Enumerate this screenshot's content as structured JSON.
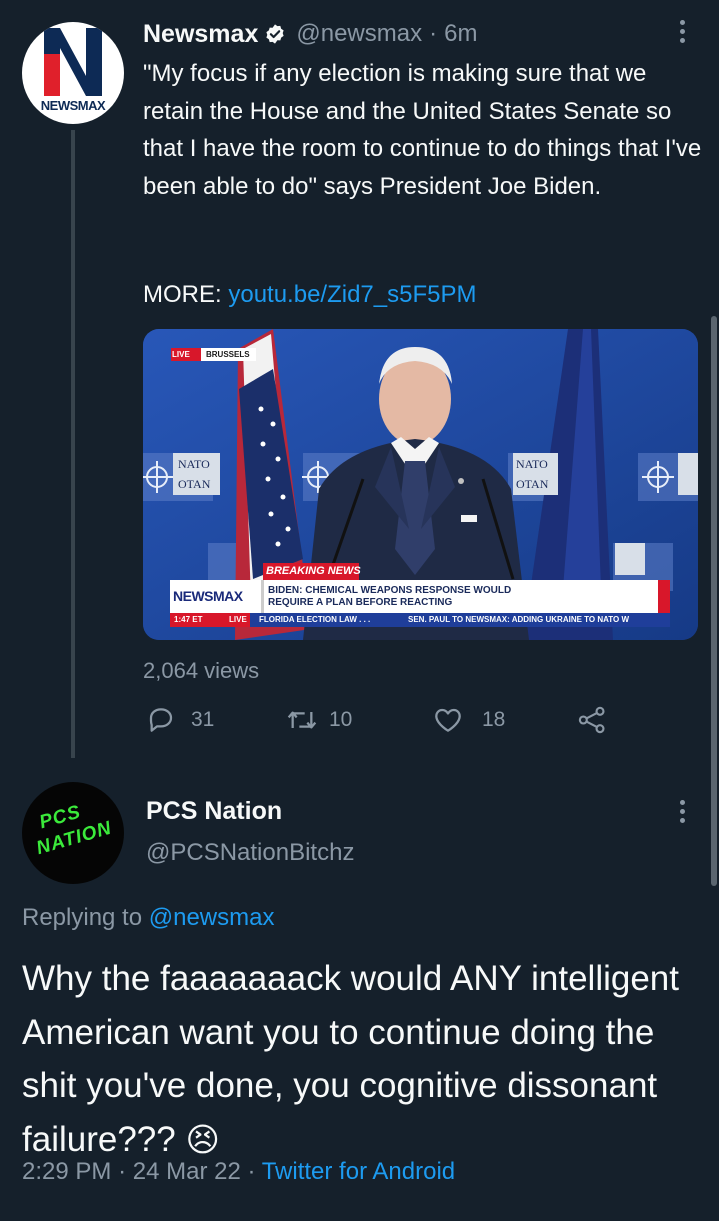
{
  "tweet": {
    "author_name": "Newsmax",
    "handle": "@newsmax",
    "separator": "·",
    "time_ago": "6m",
    "avatar_text": "NEWSMAX",
    "text": "\"My focus if any election is making sure that we retain the House and the United States Senate so that I have the room to continue to do things that I've been able to do\" says President Joe Biden.",
    "more_label": "MORE:",
    "more_link": "youtu.be/Zid7_s5F5PM",
    "video": {
      "live_tag": "LIVE",
      "location": "BRUSSELS",
      "nato_left": "NATO",
      "otan_left": "OTAN",
      "nato_right": "NATO",
      "otan_right": "OTAN",
      "breaking_label": "BREAKING NEWS",
      "channel": "NEWSMAX",
      "headline_line1": "BIDEN: CHEMICAL WEAPONS RESPONSE WOULD",
      "headline_line2": "REQUIRE A PLAN BEFORE REACTING",
      "clock": "1:47 ET",
      "live_label": "LIVE",
      "ticker1": "FLORIDA ELECTION LAW . . .",
      "ticker2": "SEN. PAUL TO NEWSMAX: ADDING UKRAINE TO NATO W"
    },
    "views": "2,064 views",
    "replies": "31",
    "retweets": "10",
    "likes": "18"
  },
  "reply": {
    "author_name": "PCS Nation",
    "handle": "@PCSNationBitchz",
    "avatar_text_line1": "PCS",
    "avatar_text_line2": "NATION",
    "replying_label": "Replying to",
    "replying_handle": "@newsmax",
    "text": "Why the faaaaaaack would ANY intelligent American want you to continue doing the shit you've done, you cognitive dissonant failure???",
    "emoji": "😣",
    "time": "2:29 PM",
    "separator": "·",
    "date": "24 Mar 22",
    "separator2": "·",
    "client": "Twitter for Android"
  },
  "colors": {
    "background": "#15202b",
    "text": "#f7f9f9",
    "muted": "#8b98a5",
    "link": "#1d9bf0",
    "accent_green": "#3bea3b"
  }
}
